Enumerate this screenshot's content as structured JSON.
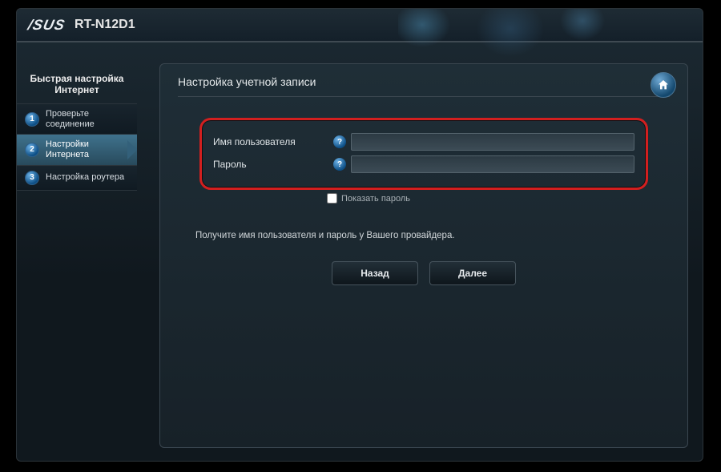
{
  "header": {
    "brand": "/SUS",
    "model": "RT-N12D1"
  },
  "sidebar": {
    "title": "Быстрая настройка Интернет",
    "steps": [
      {
        "num": "1",
        "label": "Проверьте соединение"
      },
      {
        "num": "2",
        "label": "Настройки Интернета"
      },
      {
        "num": "3",
        "label": "Настройка роутера"
      }
    ]
  },
  "panel": {
    "title": "Настройка учетной записи",
    "username_label": "Имя пользователя",
    "password_label": "Пароль",
    "show_password": "Показать пароль",
    "note": "Получите имя пользователя и пароль у Вашего провайдера.",
    "back_label": "Назад",
    "next_label": "Далее",
    "help_mark": "?",
    "username_value": "",
    "password_value": ""
  }
}
